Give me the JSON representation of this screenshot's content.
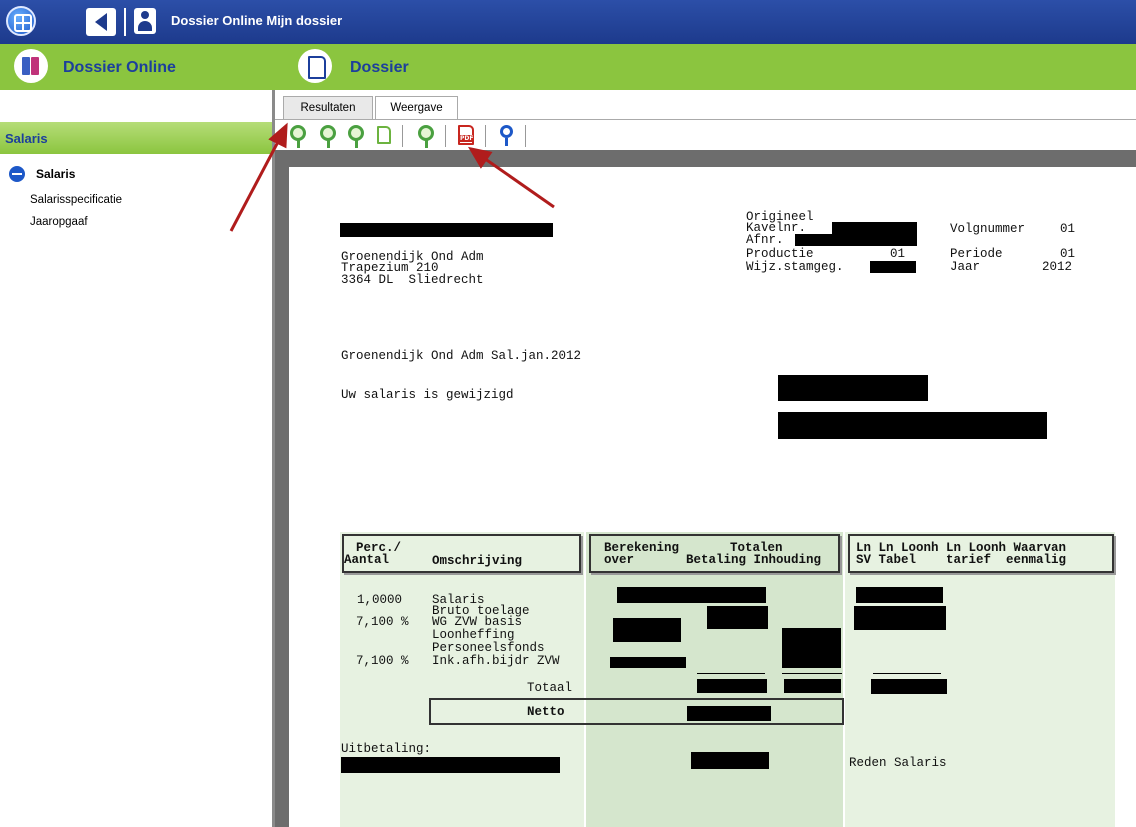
{
  "titlebar": {
    "title": "Dossier Online Mijn dossier"
  },
  "header": {
    "left_title": "Dossier Online",
    "right_title": "Dossier"
  },
  "sidebar": {
    "section_title": "Salaris",
    "tree_root": "Salaris",
    "children": [
      "Salarisspecificatie",
      "Jaaropgaaf"
    ]
  },
  "tabs": [
    "Resultaten",
    "Weergave"
  ],
  "toolbar": {
    "icons": [
      "zoom-in-icon",
      "zoom-out-icon",
      "zoom-fit-icon",
      "page-icon",
      "zoom-page-icon",
      "pdf-icon",
      "search-icon"
    ]
  },
  "document": {
    "sender": [
      "Groenendijk Ond Adm",
      "Trapezium 210",
      "3364 DL  Sliedrecht"
    ],
    "meta_labels": [
      "Origineel",
      "Kavelnr.",
      "Afnr.",
      "Productie",
      "Wijz.stamgeg."
    ],
    "productie_value": "01",
    "volgnummer_label": "Volgnummer",
    "volgnummer_value": "01",
    "periode_label": "Periode",
    "periode_value": "01",
    "jaar_label": "Jaar",
    "jaar_value": "2012",
    "subject": "Groenendijk Ond Adm Sal.jan.2012",
    "notice": "Uw salaris is gewijzigd",
    "headers": {
      "perc": "Perc./",
      "aantal": "Aantal",
      "omschrijving": "Omschrijving",
      "berekening": "Berekening",
      "over": "over",
      "totalen": "Totalen",
      "betaling_inhouding": "Betaling Inhouding",
      "right_line1": "Ln Ln Loonh Ln Loonh Waarvan",
      "right_line2": "SV Tabel    tarief  eenmalig"
    },
    "rows": [
      {
        "aantal": "1,0000  ",
        "omschrijving": "Salaris"
      },
      {
        "aantal": "",
        "omschrijving": "Bruto toelage"
      },
      {
        "aantal": "7,100 %",
        "omschrijving": "WG ZVW basis"
      },
      {
        "aantal": "",
        "omschrijving": "Loonheffing"
      },
      {
        "aantal": "",
        "omschrijving": "Personeelsfonds"
      },
      {
        "aantal": "7,100 %",
        "omschrijving": "Ink.afh.bijdr ZVW"
      }
    ],
    "totaal_label": "Totaal",
    "netto_label": "Netto",
    "uitbetaling_label": "Uitbetaling:",
    "reden_label": "Reden Salaris"
  },
  "colors": {
    "titlebar": "#1d3a8c",
    "header_green": "#8bc53f",
    "accent_blue": "#1c3f9c",
    "annotation_red": "#b01c1c"
  }
}
